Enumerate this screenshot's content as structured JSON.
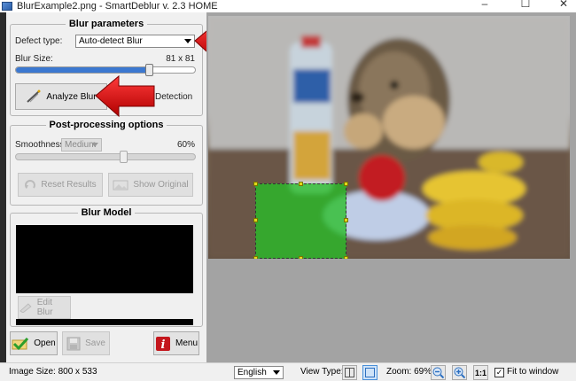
{
  "window": {
    "title": "BlurExample2.png - SmartDeblur v. 2.3 HOME",
    "minimize": "–",
    "maximize": "☐",
    "close": "✕"
  },
  "blur_parameters": {
    "title": "Blur parameters",
    "defect_type_label": "Defect type:",
    "defect_type_value": "Auto-detect Blur",
    "blur_size_label": "Blur Size:",
    "blur_size_value": "81 x 81",
    "blur_size_level": 0.74,
    "analyze_button": "Analyze Blur",
    "detection_text": "Detection"
  },
  "post_processing": {
    "title": "Post-processing options",
    "smoothness_label": "Smoothness:",
    "smoothness_mode": "Medium",
    "smoothness_value": "60%",
    "smoothness_level": 0.6,
    "reset_button": "Reset Results",
    "show_original_button": "Show Original"
  },
  "blur_model": {
    "title": "Blur Model",
    "edit_button": "Edit Blur"
  },
  "actions": {
    "open_button": "Open",
    "save_button": "Save",
    "menu_button": "Menu"
  },
  "statusbar": {
    "image_size": "Image Size: 800 x 533",
    "language": "English",
    "view_type_label": "View Type:",
    "zoom_label": "Zoom: 69%",
    "one_to_one": "1:1",
    "fit_to_window": "Fit to window",
    "fit_checked": true
  },
  "colors": {
    "accent_red": "#d40000",
    "selection_green": "#2fbe2f",
    "slider_blue": "#3b78d0",
    "menu_red": "#c4161c"
  }
}
